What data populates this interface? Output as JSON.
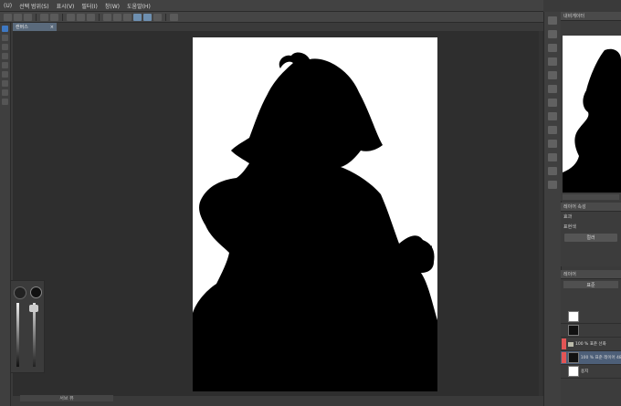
{
  "menu": [
    "(U)",
    "선택 범위(S)",
    "표시(V)",
    "필터(I)",
    "창(W)",
    "도움말(H)"
  ],
  "document": {
    "tab_label": "캔버스",
    "close_glyph": "×"
  },
  "bottom_panel": {
    "label": "서브 뷰"
  },
  "navigator": {
    "title": "내비게이터"
  },
  "properties": {
    "title": "레이어 속성",
    "effect_label": "효과",
    "expression_color_label": "표현색",
    "color_button": "컬러"
  },
  "layers": {
    "title": "레이어",
    "blend_mode": "표준",
    "rows": [
      {
        "name": "",
        "thumb": "light"
      },
      {
        "name": "",
        "thumb": "dark"
      },
      {
        "name": "100 % 표준 선화",
        "thumb": "folder"
      },
      {
        "name": "100 % 표준 레이어 48",
        "thumb": "dark"
      },
      {
        "name": "용지",
        "thumb": "light"
      }
    ]
  },
  "colors": {
    "accent": "#3e78c2",
    "selection": "#4d5f78",
    "layer_color_marker": "#e25555",
    "canvas_bg": "#ffffff",
    "silhouette": "#000000"
  }
}
